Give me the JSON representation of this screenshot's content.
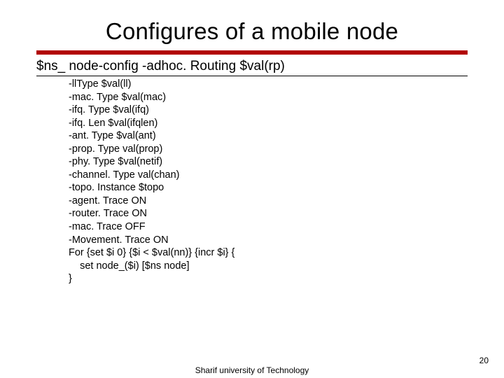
{
  "title": "Configures of a mobile node",
  "cmd": "$ns_ node-config -adhoc. Routing $val(rp)",
  "code": "-llType $val(ll)\n-mac. Type $val(mac)\n-ifq. Type $val(ifq)\n-ifq. Len $val(ifqlen)\n-ant. Type $val(ant)\n-prop. Type val(prop)\n-phy. Type $val(netif)\n-channel. Type val(chan)\n-topo. Instance $topo\n-agent. Trace ON\n-router. Trace ON\n-mac. Trace OFF\n-Movement. Trace ON\nFor {set $i 0} {$i < $val(nn)} {incr $i} {\n    set node_($i) [$ns node]\n}",
  "footer_center": "Sharif university of Technology",
  "footer_right": "20"
}
